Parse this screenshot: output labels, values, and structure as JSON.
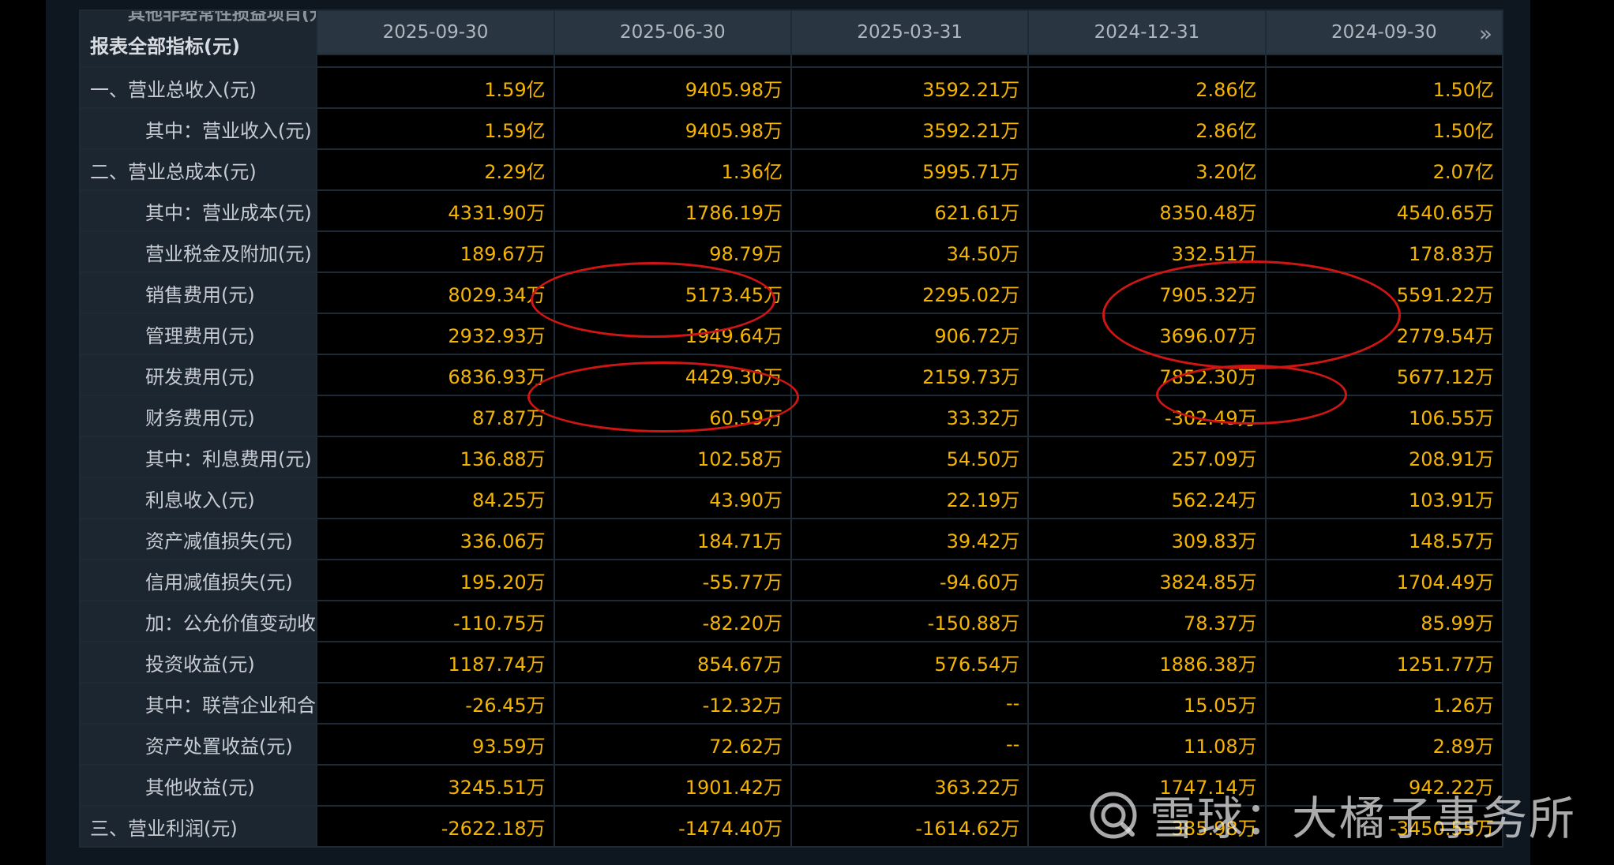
{
  "table": {
    "top_cut_label": "其他非经常性损益项目(元)",
    "header_label": "报表全部指标(元)",
    "dates": [
      "2025-09-30",
      "2025-06-30",
      "2025-03-31",
      "2024-12-31",
      "2024-09-30"
    ],
    "rows": [
      {
        "label": "一、营业总收入(元)",
        "indent": false,
        "values": [
          "1.59亿",
          "9405.98万",
          "3592.21万",
          "2.86亿",
          "1.50亿"
        ]
      },
      {
        "label": "其中：营业收入(元)",
        "indent": true,
        "values": [
          "1.59亿",
          "9405.98万",
          "3592.21万",
          "2.86亿",
          "1.50亿"
        ]
      },
      {
        "label": "二、营业总成本(元)",
        "indent": false,
        "values": [
          "2.29亿",
          "1.36亿",
          "5995.71万",
          "3.20亿",
          "2.07亿"
        ]
      },
      {
        "label": "其中：营业成本(元)",
        "indent": true,
        "values": [
          "4331.90万",
          "1786.19万",
          "621.61万",
          "8350.48万",
          "4540.65万"
        ]
      },
      {
        "label": "营业税金及附加(元)",
        "indent": true,
        "values": [
          "189.67万",
          "98.79万",
          "34.50万",
          "332.51万",
          "178.83万"
        ]
      },
      {
        "label": "销售费用(元)",
        "indent": true,
        "values": [
          "8029.34万",
          "5173.45万",
          "2295.02万",
          "7905.32万",
          "5591.22万"
        ]
      },
      {
        "label": "管理费用(元)",
        "indent": true,
        "values": [
          "2932.93万",
          "1949.64万",
          "906.72万",
          "3696.07万",
          "2779.54万"
        ]
      },
      {
        "label": "研发费用(元)",
        "indent": true,
        "values": [
          "6836.93万",
          "4429.30万",
          "2159.73万",
          "7852.30万",
          "5677.12万"
        ]
      },
      {
        "label": "财务费用(元)",
        "indent": true,
        "values": [
          "87.87万",
          "60.59万",
          "33.32万",
          "-302.49万",
          "106.55万"
        ]
      },
      {
        "label": "其中：利息费用(元)",
        "indent": true,
        "values": [
          "136.88万",
          "102.58万",
          "54.50万",
          "257.09万",
          "208.91万"
        ]
      },
      {
        "label": "利息收入(元)",
        "indent": true,
        "values": [
          "84.25万",
          "43.90万",
          "22.19万",
          "562.24万",
          "103.91万"
        ]
      },
      {
        "label": "资产减值损失(元)",
        "indent": true,
        "values": [
          "336.06万",
          "184.71万",
          "39.42万",
          "309.83万",
          "148.57万"
        ]
      },
      {
        "label": "信用减值损失(元)",
        "indent": true,
        "values": [
          "195.20万",
          "-55.77万",
          "-94.60万",
          "3824.85万",
          "1704.49万"
        ]
      },
      {
        "label": "加：公允价值变动收益(元)",
        "indent": true,
        "values": [
          "-110.75万",
          "-82.20万",
          "-150.88万",
          "78.37万",
          "85.99万"
        ]
      },
      {
        "label": "投资收益(元)",
        "indent": true,
        "values": [
          "1187.74万",
          "854.67万",
          "576.54万",
          "1886.38万",
          "1251.77万"
        ]
      },
      {
        "label": "其中：联营企业和合营企业的投资收益(元)",
        "indent": true,
        "values": [
          "-26.45万",
          "-12.32万",
          "--",
          "15.05万",
          "1.26万"
        ]
      },
      {
        "label": "资产处置收益(元)",
        "indent": true,
        "values": [
          "93.59万",
          "72.62万",
          "--",
          "11.08万",
          "2.89万"
        ]
      },
      {
        "label": "其他收益(元)",
        "indent": true,
        "values": [
          "3245.51万",
          "1901.42万",
          "363.22万",
          "1747.14万",
          "942.22万"
        ]
      },
      {
        "label": "三、营业利润(元)",
        "indent": false,
        "values": [
          "-2622.18万",
          "-1474.40万",
          "-1614.62万",
          "385.98万",
          "-3450.55万"
        ]
      }
    ]
  },
  "nav": {
    "next_icon": "double-chevron-right-icon",
    "next_glyph": "»"
  },
  "watermark": {
    "text": "雪球：大橘子事务所",
    "icon": "snowball-logo-icon"
  },
  "colors": {
    "value": "#f5b400",
    "label": "#c8ccd2",
    "annotation": "#d01515",
    "background": "#0e1620"
  }
}
